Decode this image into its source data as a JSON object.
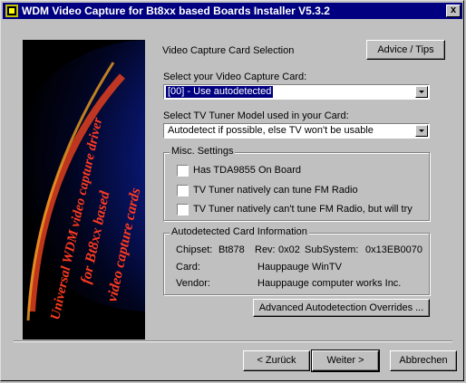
{
  "window": {
    "title": "WDM Video Capture for Bt8xx based Boards Installer V5.3.2",
    "close_glyph": "x"
  },
  "banner": {
    "lines": [
      "Universal WDM video capture driver",
      "for Bt8xx based",
      "video capture cards"
    ]
  },
  "header": {
    "section_title": "Video Capture Card Selection",
    "advice_button": "Advice / Tips"
  },
  "card_select": {
    "label": "Select your Video Capture Card:",
    "value": "[00] - Use autodetected"
  },
  "tuner_select": {
    "label": "Select TV Tuner Model used in your Card:",
    "value": "Autodetect if possible, else TV won't be usable"
  },
  "misc": {
    "title": "Misc. Settings",
    "options": [
      {
        "label": "Has TDA9855 On Board",
        "checked": false
      },
      {
        "label": "TV Tuner natively can tune FM Radio",
        "checked": false
      },
      {
        "label": "TV Tuner natively can't tune FM Radio, but will try",
        "checked": false
      }
    ]
  },
  "autodetected": {
    "title": "Autodetected Card Information",
    "chipset_label": "Chipset:",
    "chipset_value": "Bt878",
    "rev_label": "Rev:",
    "rev_value": "0x02",
    "subsystem_label": "SubSystem:",
    "subsystem_value": "0x13EB0070",
    "card_label": "Card:",
    "card_value": "Hauppauge WinTV",
    "vendor_label": "Vendor:",
    "vendor_value": "Hauppauge computer works Inc."
  },
  "overrides_button": "Advanced Autodetection Overrides ...",
  "footer": {
    "back": "< Zurück",
    "next": "Weiter >",
    "cancel": "Abbrechen"
  }
}
